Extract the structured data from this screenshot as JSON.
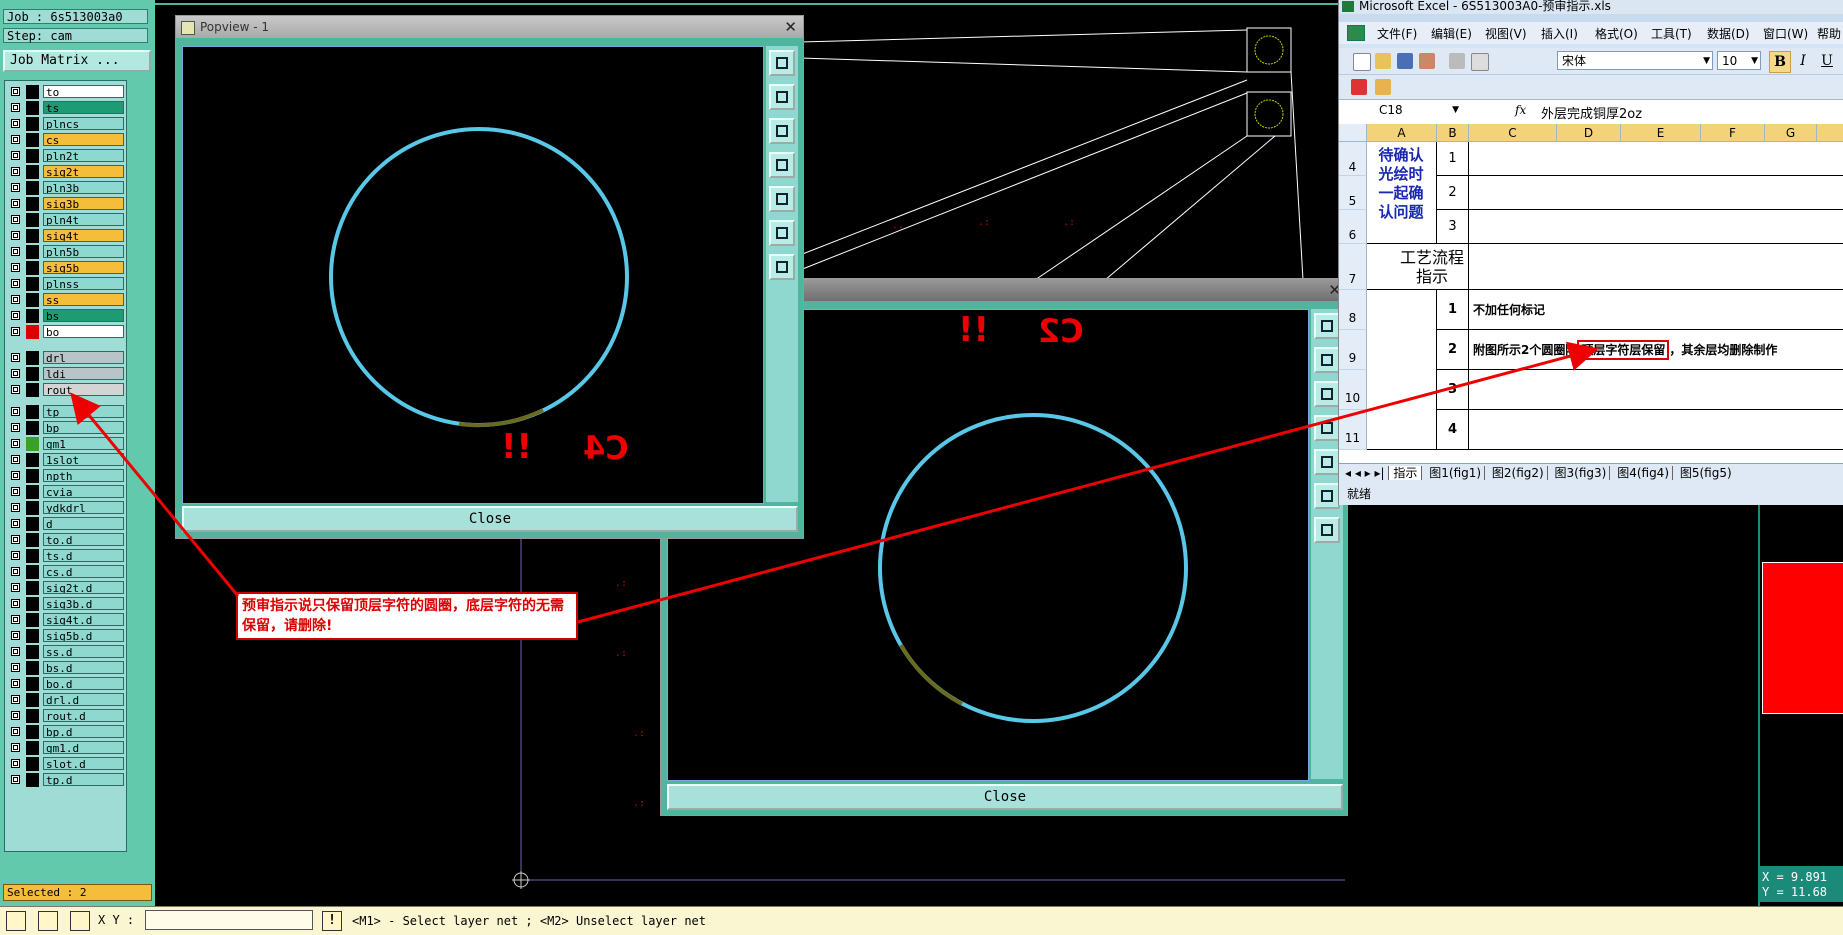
{
  "left_panel": {
    "job_label": "Job : 6s513003a0",
    "step_label": "Step: cam",
    "job_matrix_button": "Job Matrix ...",
    "selected_label": "Selected : 2",
    "layers": [
      {
        "name": "to",
        "color": "#ffffff",
        "swatch": "#000"
      },
      {
        "name": "ts",
        "color": "#1e9b73",
        "swatch": "#000"
      },
      {
        "name": "plncs",
        "color": "#8fd8d0",
        "swatch": "#000"
      },
      {
        "name": "cs",
        "color": "#f4bd3a",
        "swatch": "#000"
      },
      {
        "name": "pln2t",
        "color": "#8fd8d0",
        "swatch": "#000"
      },
      {
        "name": "sig2t",
        "color": "#f4bd3a",
        "swatch": "#000"
      },
      {
        "name": "pln3b",
        "color": "#8fd8d0",
        "swatch": "#000"
      },
      {
        "name": "sig3b",
        "color": "#f4bd3a",
        "swatch": "#000"
      },
      {
        "name": "pln4t",
        "color": "#8fd8d0",
        "swatch": "#000"
      },
      {
        "name": "sig4t",
        "color": "#f4bd3a",
        "swatch": "#000"
      },
      {
        "name": "pln5b",
        "color": "#8fd8d0",
        "swatch": "#000"
      },
      {
        "name": "sig5b",
        "color": "#f4bd3a",
        "swatch": "#000"
      },
      {
        "name": "plnss",
        "color": "#8fd8d0",
        "swatch": "#000"
      },
      {
        "name": "ss",
        "color": "#f4bd3a",
        "swatch": "#000"
      },
      {
        "name": "bs",
        "color": "#1e9b73",
        "swatch": "#000"
      },
      {
        "name": "bo",
        "color": "#ffffff",
        "swatch": "#d00"
      },
      {
        "name": "drl",
        "color": "#b9c4c8",
        "swatch": "#000"
      },
      {
        "name": "ldi",
        "color": "#b9c4c8",
        "swatch": "#000"
      },
      {
        "name": "rout",
        "color": "#d4d4d4",
        "swatch": "#000"
      },
      {
        "name": "tp",
        "color": "#8fd8d0",
        "swatch": "#000"
      },
      {
        "name": "bp",
        "color": "#8fd8d0",
        "swatch": "#000"
      },
      {
        "name": "gm1",
        "color": "#8fd8d0",
        "swatch": "#3c9f2a"
      },
      {
        "name": "1slot",
        "color": "#8fd8d0",
        "swatch": "#000"
      },
      {
        "name": "npth",
        "color": "#8fd8d0",
        "swatch": "#000"
      },
      {
        "name": "cvia",
        "color": "#8fd8d0",
        "swatch": "#000"
      },
      {
        "name": "ydkdrl",
        "color": "#8fd8d0",
        "swatch": "#000"
      },
      {
        "name": "d",
        "color": "#8fd8d0",
        "swatch": "#000"
      },
      {
        "name": "to.d",
        "color": "#8fd8d0",
        "swatch": "#000"
      },
      {
        "name": "ts.d",
        "color": "#8fd8d0",
        "swatch": "#000"
      },
      {
        "name": "cs.d",
        "color": "#8fd8d0",
        "swatch": "#000"
      },
      {
        "name": "sig2t.d",
        "color": "#8fd8d0",
        "swatch": "#000"
      },
      {
        "name": "sig3b.d",
        "color": "#8fd8d0",
        "swatch": "#000"
      },
      {
        "name": "sig4t.d",
        "color": "#8fd8d0",
        "swatch": "#000"
      },
      {
        "name": "sig5b.d",
        "color": "#8fd8d0",
        "swatch": "#000"
      },
      {
        "name": "ss.d",
        "color": "#8fd8d0",
        "swatch": "#000"
      },
      {
        "name": "bs.d",
        "color": "#8fd8d0",
        "swatch": "#000"
      },
      {
        "name": "bo.d",
        "color": "#8fd8d0",
        "swatch": "#000"
      },
      {
        "name": "drl.d",
        "color": "#8fd8d0",
        "swatch": "#000"
      },
      {
        "name": "rout.d",
        "color": "#8fd8d0",
        "swatch": "#000"
      },
      {
        "name": "bp.d",
        "color": "#8fd8d0",
        "swatch": "#000"
      },
      {
        "name": "gm1.d",
        "color": "#8fd8d0",
        "swatch": "#000"
      },
      {
        "name": "slot.d",
        "color": "#8fd8d0",
        "swatch": "#000"
      },
      {
        "name": "tp.d",
        "color": "#8fd8d0",
        "swatch": "#000"
      }
    ]
  },
  "popview1": {
    "title": "Popview - 1",
    "close_label": "Close",
    "marker_text": "!!",
    "ref_text": "C4"
  },
  "popview2": {
    "close_label": "Close",
    "marker_text": "!!",
    "ref_text": "C2"
  },
  "excel": {
    "title": "Microsoft Excel - 6S513003A0-预审指示.xls",
    "menu": [
      "文件(F)",
      "编辑(E)",
      "视图(V)",
      "插入(I)",
      "格式(O)",
      "工具(T)",
      "数据(D)",
      "窗口(W)",
      "帮助"
    ],
    "font_name": "宋体",
    "font_size": "10",
    "bold": "B",
    "italic": "I",
    "underline": "U",
    "name_box": "C18",
    "fx": "fx",
    "formula": "外层完成铜厚2oz",
    "col_headers": [
      "A",
      "B",
      "C",
      "D",
      "E",
      "F",
      "G"
    ],
    "row_headers": [
      "4",
      "5",
      "6",
      "7",
      "8",
      "9",
      "10",
      "11"
    ],
    "a_block_text": "待确认光绘时一起确认问题",
    "b_numbers_top": [
      "1",
      "2",
      "3"
    ],
    "process_label": "工艺流程指示",
    "b_numbers_bottom": [
      "1",
      "2",
      "3",
      "4"
    ],
    "row8_text": "不加任何标记",
    "row9_text_a": "附图所示2个圆圈除",
    "row9_text_highlight": "顶层字符层保留",
    "row9_text_b": "，其余层均删除制作",
    "sheet_tabs": [
      "指示",
      "图1(fig1)",
      "图2(fig2)",
      "图3(fig3)",
      "图4(fig4)",
      "图5(fig5)"
    ],
    "status": "就绪"
  },
  "annotation": {
    "text": "预审指示说只保留顶层字符的圆圈，底层字符的无需保留，请删除!"
  },
  "coords": {
    "x_label": "X = 9.891",
    "y_label": "Y = 11.68"
  },
  "bottom_bar": {
    "xy_label": "X Y :",
    "xy_value": "",
    "help_text": "<M1> - Select layer net ; <M2> Unselect layer net"
  }
}
